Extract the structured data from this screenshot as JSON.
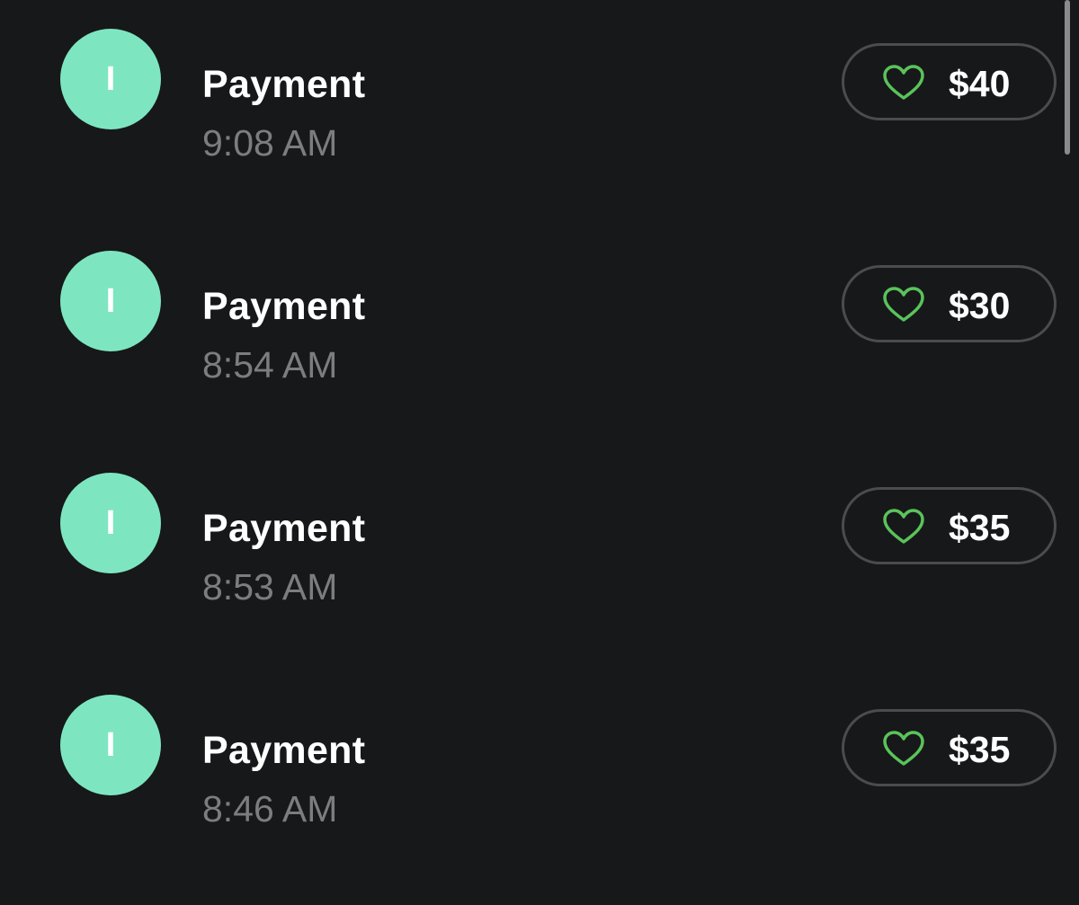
{
  "transactions": [
    {
      "avatar_initial": "I",
      "title": "Payment",
      "time": "9:08 AM",
      "amount": "$40"
    },
    {
      "avatar_initial": "I",
      "title": "Payment",
      "time": "8:54 AM",
      "amount": "$30"
    },
    {
      "avatar_initial": "I",
      "title": "Payment",
      "time": "8:53 AM",
      "amount": "$35"
    },
    {
      "avatar_initial": "I",
      "title": "Payment",
      "time": "8:46 AM",
      "amount": "$35"
    }
  ],
  "colors": {
    "background": "#17181a",
    "avatar": "#7de6c0",
    "heart": "#5ac35a",
    "pill_border": "#4b4c4e",
    "secondary_text": "#7c7d80"
  },
  "icons": {
    "like": "heart-outline-icon"
  }
}
